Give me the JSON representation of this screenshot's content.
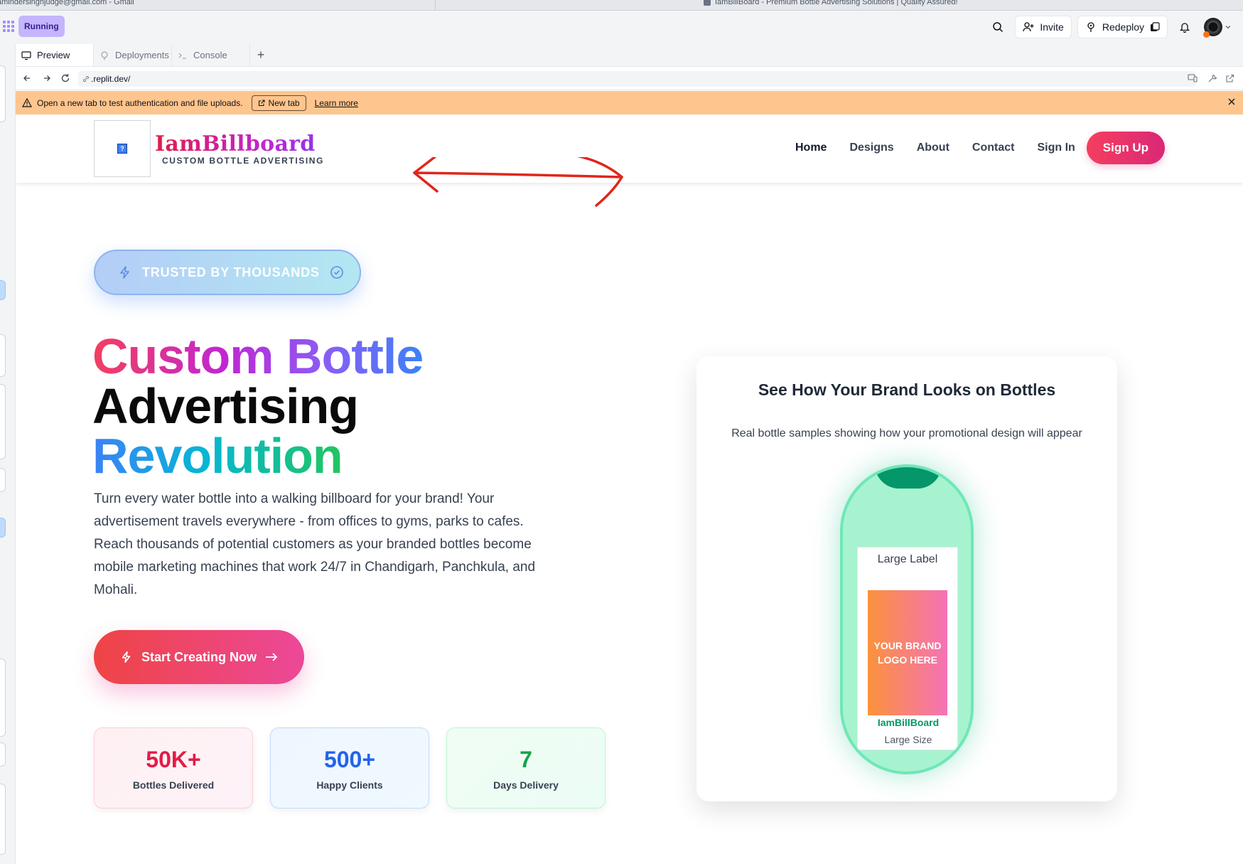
{
  "browser": {
    "tab1_title": "amindersinghjudge@gmail.com - Gmail",
    "tab2_title": "IamBillBoard - Premium Bottle Advertising Solutions | Quality Assured!"
  },
  "topbar": {
    "status": "Running",
    "invite_label": "Invite",
    "redeploy_label": "Redeploy"
  },
  "panel": {
    "tabs": [
      {
        "label": "Preview"
      },
      {
        "label": "Deployments"
      },
      {
        "label": "Console"
      }
    ],
    "add_tab": "+",
    "url": ".replit.dev/"
  },
  "banner": {
    "message": "Open a new tab to test authentication and file uploads.",
    "new_tab_label": "New tab",
    "learn_more_label": "Learn more"
  },
  "site": {
    "logo_alt": "?",
    "brand_name": "IamBillboard",
    "brand_tagline": "CUSTOM BOTTLE ADVERTISING",
    "nav": {
      "home": "Home",
      "designs": "Designs",
      "about": "About",
      "contact": "Contact",
      "sign_in": "Sign In",
      "sign_up": "Sign Up"
    },
    "hero": {
      "badge": "TRUSTED BY THOUSANDS",
      "title_line1": "Custom Bottle",
      "title_line2": "Advertising",
      "title_line3": "Revolution",
      "lead": "Turn every water bottle into a walking billboard for your brand! Your advertisement travels everywhere - from offices to gyms, parks to cafes. Reach thousands of potential customers as your branded bottles become mobile marketing machines that work 24/7 in Chandigarh, Panchkula, and Mohali.",
      "cta_label": "Start Creating Now"
    },
    "stats": [
      {
        "value": "50K+",
        "label": "Bottles Delivered"
      },
      {
        "value": "500+",
        "label": "Happy Clients"
      },
      {
        "value": "7",
        "label": "Days Delivery"
      }
    ],
    "preview": {
      "title": "See How Your Brand Looks on Bottles",
      "subtitle": "Real bottle samples showing how your promotional design will appear",
      "label_title": "Large Label",
      "logo_placeholder": "YOUR BRAND LOGO HERE",
      "brand": "IamBillBoard",
      "size": "Large Size"
    }
  },
  "colors": {
    "running_badge": "#c4b5fd",
    "banner_bg": "#ffc58e",
    "signup_gradient_start": "#f43f5e",
    "signup_gradient_end": "#db2777",
    "bottle": "#a7f3d0",
    "bottle_cap": "#059669",
    "annotation_arrow": "#e0261b"
  }
}
